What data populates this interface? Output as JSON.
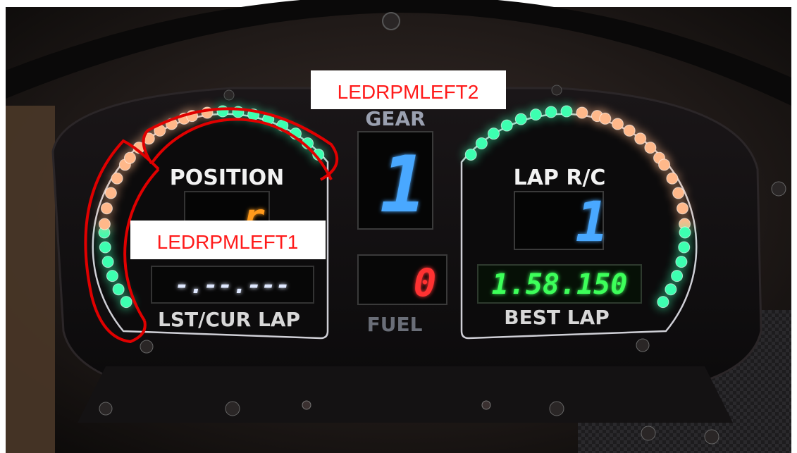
{
  "panel": {
    "position_label": "POSITION",
    "position_value": "r",
    "gear_label": "GEAR",
    "gear_value": "1",
    "lap_rc_label": "LAP R/C",
    "lap_rc_value": "1",
    "lst_cur_display": "-.--.---",
    "lst_cur_label": "LST/CUR LAP",
    "fuel_value": "0",
    "fuel_label": "FUEL",
    "best_lap_value": "1.58.150",
    "best_lap_label": "BEST LAP"
  },
  "annotations": {
    "callout_top": "LEDRPMLEFT2",
    "callout_left": "LEDRPMLEFT1",
    "outline_color": "#e00000"
  },
  "led_colors": {
    "green": "#3dffb0",
    "amber": "#ffb88a",
    "blue_digit": "#4aa8ff",
    "red_digit": "#ff3030",
    "amber_digit": "#ff9a1a",
    "green_digit": "#3cff5a"
  }
}
